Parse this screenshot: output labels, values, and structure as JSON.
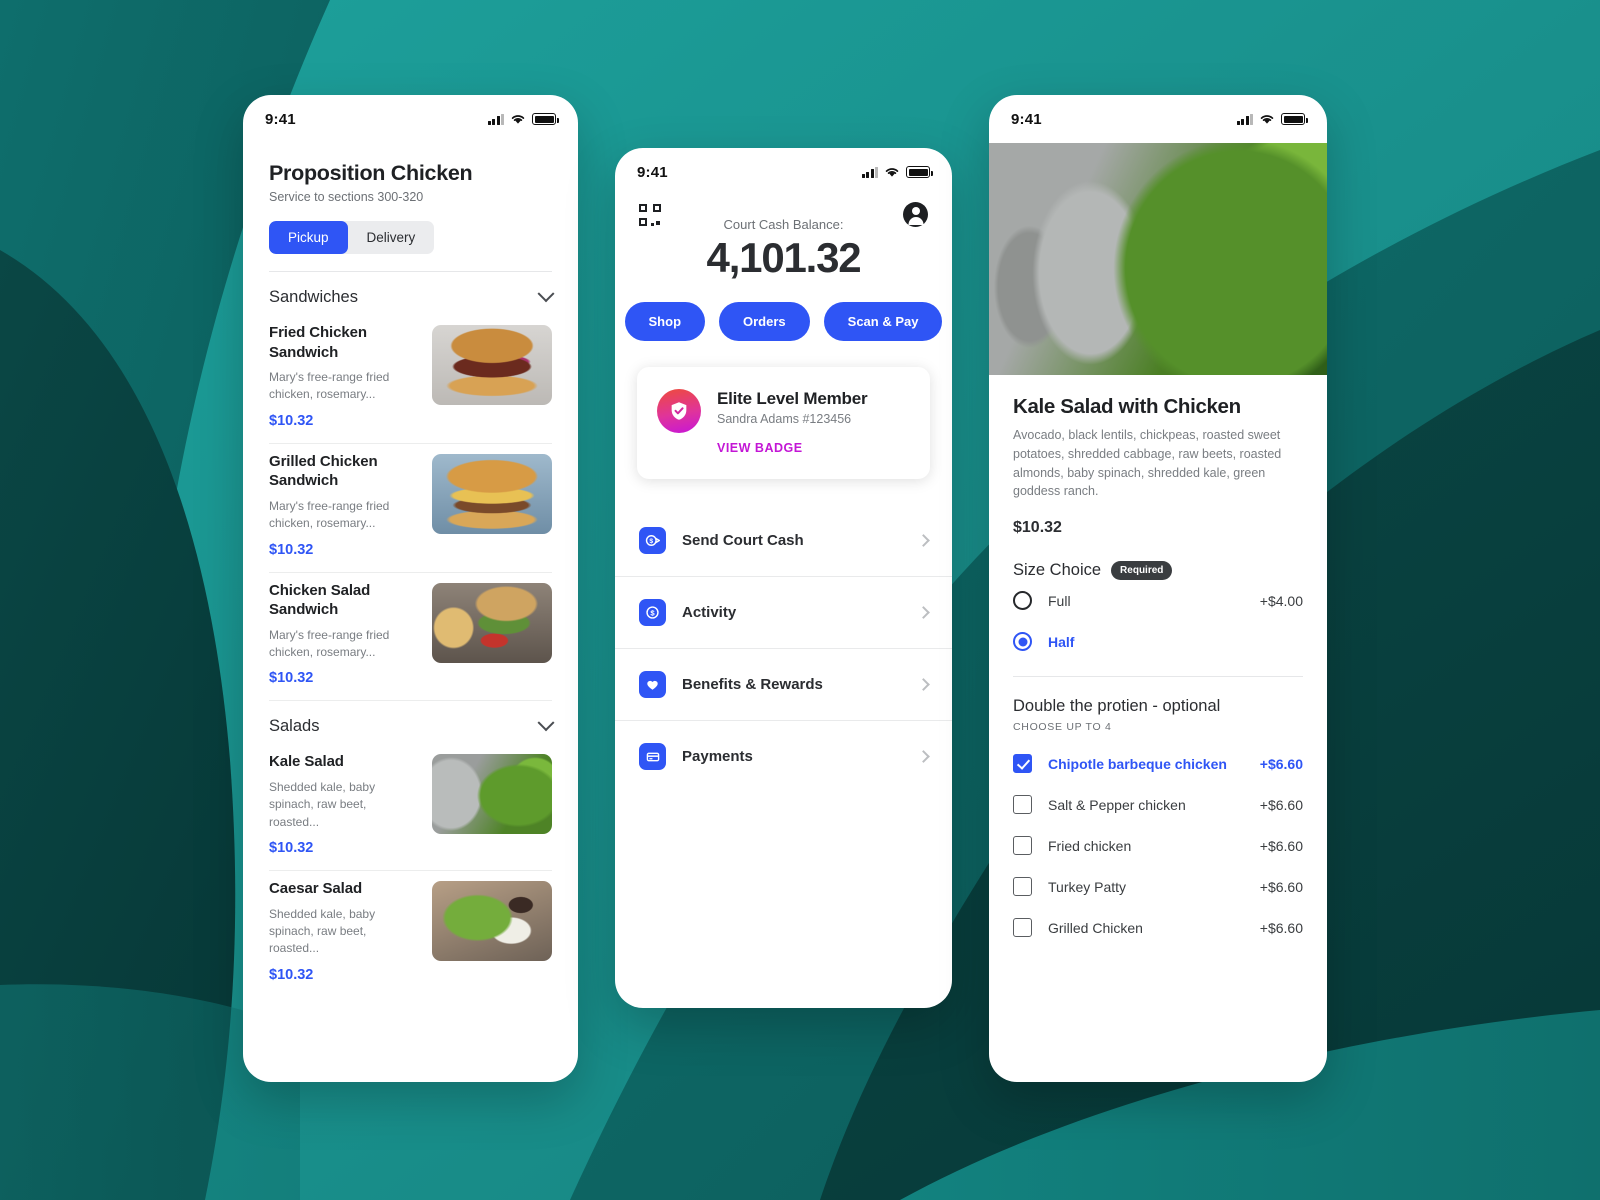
{
  "background": {
    "teal_light": "#1a9490",
    "teal_mid": "#0f6f6d",
    "teal_dark": "#0b4a48",
    "teal_deep": "#083a39"
  },
  "accent": {
    "blue": "#2f55f5",
    "magenta": "#c316d5",
    "badge_dark": "#3a3d40"
  },
  "statusbar": {
    "time": "9:41",
    "signal_icon": "cellular-bars-icon",
    "wifi_icon": "wifi-icon",
    "battery_icon": "battery-full-icon"
  },
  "phone_menu": {
    "title": "Proposition Chicken",
    "subtitle": "Service to sections 300-320",
    "segmented": {
      "options": [
        "Pickup",
        "Delivery"
      ],
      "selected": "Pickup"
    },
    "categories": [
      {
        "name": "Sandwiches",
        "chevron": "chevron-down-icon",
        "items": [
          {
            "name": "Fried Chicken Sandwich",
            "desc": "Mary's free-range fried chicken, rosemary...",
            "price": "$10.32",
            "thumb": "img-fried"
          },
          {
            "name": "Grilled Chicken Sandwich",
            "desc": "Mary's free-range fried chicken, rosemary...",
            "price": "$10.32",
            "thumb": "img-grilled"
          },
          {
            "name": "Chicken Salad Sandwich",
            "desc": "Mary's free-range fried chicken, rosemary...",
            "price": "$10.32",
            "thumb": "img-chxsalad"
          }
        ]
      },
      {
        "name": "Salads",
        "chevron": "chevron-down-icon",
        "items": [
          {
            "name": "Kale Salad",
            "desc": "Shedded kale, baby spinach, raw beet, roasted...",
            "price": "$10.32",
            "thumb": "img-kale"
          },
          {
            "name": "Caesar Salad",
            "desc": "Shedded kale, baby spinach, raw beet, roasted...",
            "price": "$10.32",
            "thumb": "img-caesar"
          }
        ]
      }
    ]
  },
  "phone_wallet": {
    "qr_icon": "qr-code-icon",
    "profile_icon": "account-circle-icon",
    "balance_label": "Court Cash Balance:",
    "balance_amount": "4,101.32",
    "actions": [
      {
        "label": "Shop"
      },
      {
        "label": "Orders"
      },
      {
        "label": "Scan & Pay"
      }
    ],
    "member_card": {
      "badge_icon": "shield-check-icon",
      "title": "Elite Level Member",
      "subtitle": "Sandra Adams #123456",
      "link": "VIEW BADGE"
    },
    "menu_rows": [
      {
        "label": "Send Court Cash",
        "icon": "dollar-send-icon"
      },
      {
        "label": "Activity",
        "icon": "dollar-circle-icon"
      },
      {
        "label": "Benefits & Rewards",
        "icon": "heart-icon"
      },
      {
        "label": "Payments",
        "icon": "credit-card-icon"
      }
    ],
    "chevron_icon": "chevron-right-icon"
  },
  "phone_detail": {
    "hero_image": "kale-salad-photo",
    "title": "Kale Salad with Chicken",
    "description": "Avocado, black lentils, chickpeas, roasted sweet potatoes, shredded cabbage, raw beets, roasted almonds, baby spinach, shredded kale, green goddess ranch.",
    "price": "$10.32",
    "size_group": {
      "title": "Size Choice",
      "badge": "Required",
      "options": [
        {
          "label": "Full",
          "price": "+$4.00",
          "selected": false
        },
        {
          "label": "Half",
          "price": "",
          "selected": true
        }
      ]
    },
    "protein_group": {
      "title": "Double the protien - optional",
      "subtitle": "CHOOSE UP TO 4",
      "options": [
        {
          "label": "Chipotle barbeque chicken",
          "price": "+$6.60",
          "checked": true
        },
        {
          "label": "Salt & Pepper chicken",
          "price": "+$6.60",
          "checked": false
        },
        {
          "label": "Fried chicken",
          "price": "+$6.60",
          "checked": false
        },
        {
          "label": "Turkey Patty",
          "price": "+$6.60",
          "checked": false
        },
        {
          "label": "Grilled Chicken",
          "price": "+$6.60",
          "checked": false
        }
      ]
    }
  }
}
